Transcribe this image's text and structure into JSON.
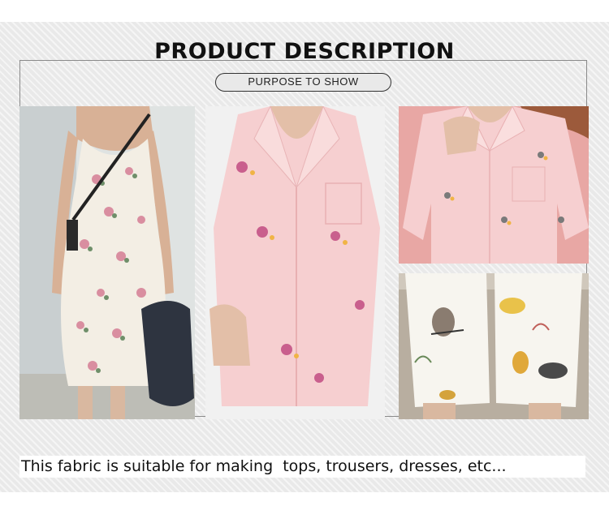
{
  "header": {
    "title": "PRODUCT DESCRIPTION",
    "subtitle": "PURPOSE TO SHOW"
  },
  "photos": [
    {
      "subject": "model-in-floral-slip-dress"
    },
    {
      "subject": "pink-floral-pajama-shirt"
    },
    {
      "subject": "pink-pajama-set-with-pocket"
    },
    {
      "subject": "white-animal-print-shorts"
    }
  ],
  "caption": "This fabric is suitable for making  tops, trousers, dresses, etc...",
  "colors": {
    "background": "#e9e9e9",
    "frame": "#8a8a8a",
    "pink_fabric": "#f6cfd0",
    "floral_cream": "#f3eee4",
    "print_white": "#f7f5ef"
  }
}
